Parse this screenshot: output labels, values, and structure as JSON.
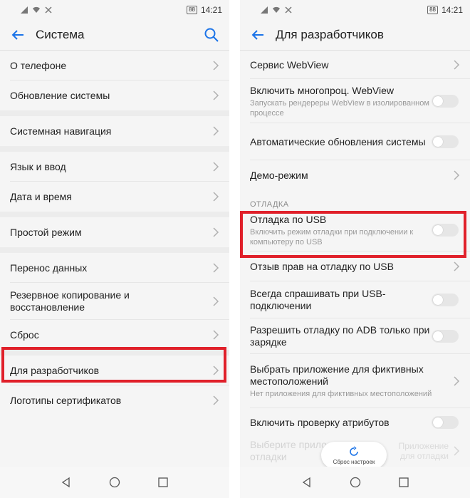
{
  "status": {
    "battery": "88",
    "time": "14:21"
  },
  "left": {
    "title": "Система",
    "items": [
      "О телефоне",
      "Обновление системы",
      "Системная навигация",
      "Язык и ввод",
      "Дата и время",
      "Простой режим",
      "Перенос данных",
      "Резервное копирование и восстановление",
      "Сброс",
      "Для разработчиков",
      "Логотипы сертификатов"
    ]
  },
  "right": {
    "title": "Для разработчиков",
    "webview_service": "Сервис WebView",
    "multiprocess": {
      "label": "Включить многопроц. WebView",
      "sub": "Запускать рендереры WebView в изолированном процессе"
    },
    "auto_updates": "Автоматические обновления системы",
    "demo_mode": "Демо-режим",
    "section_debug": "ОТЛАДКА",
    "usb_debug": {
      "label": "Отладка по USB",
      "sub": "Включить режим отладки при подключении к компьютеру по USB"
    },
    "revoke_usb": "Отзыв прав на отладку по USB",
    "always_ask": "Всегда спрашивать при USB-подключении",
    "adb_charging": "Разрешить отладку по ADB только при зарядке",
    "mock_location": {
      "label": "Выбрать приложение для фиктивных местоположений",
      "sub": "Нет приложения для фиктивных местоположений"
    },
    "attr_check": "Включить проверку атрибутов",
    "debug_app_left": "Выберите прило",
    "debug_app_left2": "отладки",
    "debug_app_right": "Приложение",
    "debug_app_right2": "для отладки",
    "reset_label": "Сброс настроек"
  },
  "colors": {
    "highlight": "#e0202a",
    "accent": "#1a73e8"
  }
}
